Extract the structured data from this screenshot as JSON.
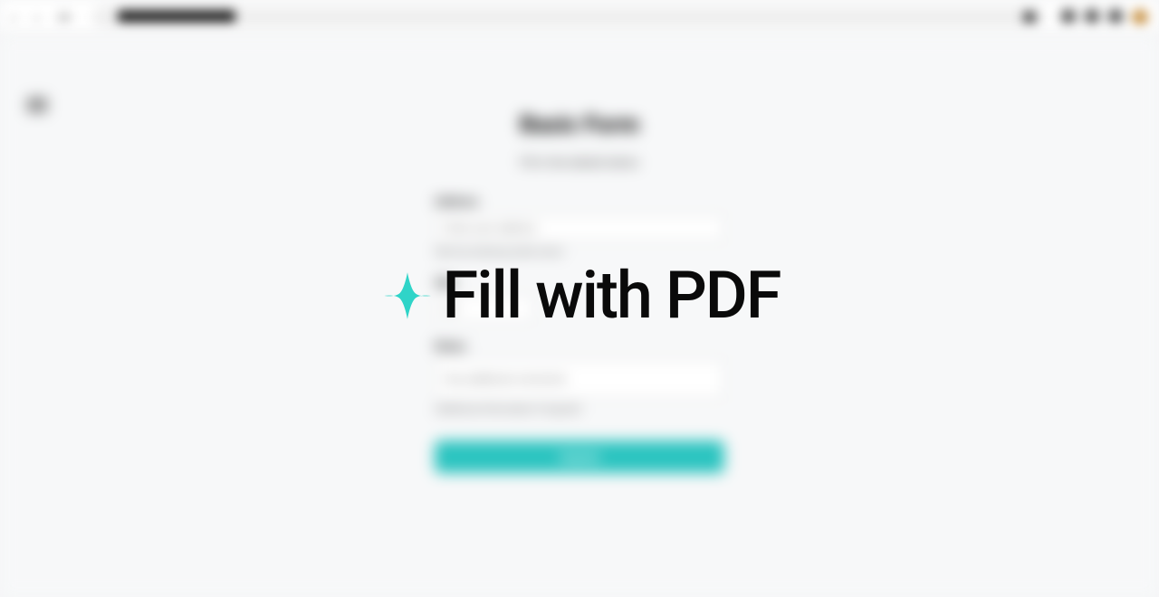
{
  "overlay": {
    "text": "Fill with PDF",
    "icon": "sparkle-icon"
  },
  "background_form": {
    "title": "Basic Form",
    "subtitle": "Fill in the details below",
    "fields": [
      {
        "label": "Address",
        "placeholder": "Enter your address",
        "hint": "Start by entering street name"
      },
      {
        "label": "Age",
        "placeholder": "25",
        "hint": ""
      },
      {
        "label": "Notes",
        "placeholder": "Any additional comments",
        "hint": "Additional information if required"
      }
    ],
    "submit_label": "Submit"
  },
  "colors": {
    "accent": "#2bc4c0",
    "sparkle": "#2fd4c8",
    "text": "#0a0a0a"
  }
}
